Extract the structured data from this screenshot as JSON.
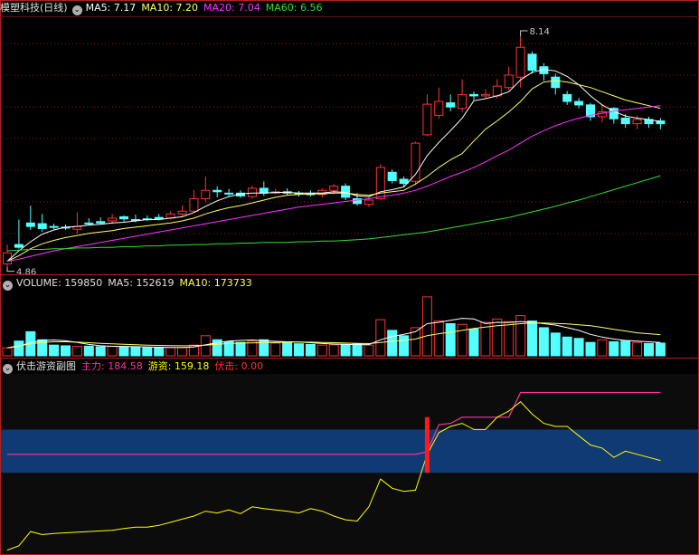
{
  "header": {
    "stock_name": "模塑科技(日线)",
    "ma5": "MA5: 7.17",
    "ma10": "MA10: 7.20",
    "ma20": "MA20: 7.04",
    "ma60": "MA60: 6.56"
  },
  "volume_header": {
    "volume": "VOLUME: 159850",
    "ma5": "MA5: 152619",
    "ma10": "MA10: 173733"
  },
  "indicator_header": {
    "name": "伏击游资副图",
    "zhuli": "主力: 184.58",
    "youzi": "游资: 159.18",
    "fuji": "伏击: 0.00"
  },
  "colors": {
    "up": "#ff3232",
    "down": "#54ffff",
    "ma5": "#ffffff",
    "ma10": "#ffff66",
    "ma20": "#ff33ff",
    "ma60": "#33dd33",
    "zhuli": "#ff3399",
    "youzi": "#ffff00",
    "band": "#103a74"
  },
  "chart_data": [
    {
      "type": "candlestick",
      "annotations": {
        "high": "8.14",
        "low": "4.86"
      },
      "ylim": [
        4.75,
        8.4
      ],
      "candles": [
        [
          4.86,
          5.02,
          4.82,
          5.14
        ],
        [
          5.14,
          5.1,
          5.08,
          5.5
        ],
        [
          5.45,
          5.4,
          5.35,
          5.7
        ],
        [
          5.44,
          5.37,
          5.32,
          5.58
        ],
        [
          5.4,
          5.39,
          5.36,
          5.44
        ],
        [
          5.39,
          5.38,
          5.35,
          5.43
        ],
        [
          5.36,
          5.4,
          5.3,
          5.6
        ],
        [
          5.45,
          5.44,
          5.42,
          5.52
        ],
        [
          5.47,
          5.45,
          5.43,
          5.53
        ],
        [
          5.48,
          5.52,
          5.44,
          5.58
        ],
        [
          5.54,
          5.51,
          5.47,
          5.56
        ],
        [
          5.5,
          5.49,
          5.46,
          5.57
        ],
        [
          5.51,
          5.5,
          5.48,
          5.56
        ],
        [
          5.53,
          5.51,
          5.49,
          5.58
        ],
        [
          5.52,
          5.58,
          5.5,
          5.62
        ],
        [
          5.58,
          5.62,
          5.55,
          5.7
        ],
        [
          5.62,
          5.8,
          5.6,
          5.92
        ],
        [
          5.8,
          5.92,
          5.75,
          6.12
        ],
        [
          5.92,
          5.9,
          5.82,
          5.98
        ],
        [
          5.88,
          5.87,
          5.83,
          5.94
        ],
        [
          5.88,
          5.84,
          5.81,
          5.92
        ],
        [
          5.83,
          5.95,
          5.8,
          5.99
        ],
        [
          5.95,
          5.88,
          5.84,
          6.05
        ],
        [
          5.88,
          5.9,
          5.86,
          5.94
        ],
        [
          5.9,
          5.88,
          5.85,
          5.95
        ],
        [
          5.88,
          5.87,
          5.83,
          5.91
        ],
        [
          5.87,
          5.86,
          5.83,
          5.92
        ],
        [
          5.86,
          5.92,
          5.82,
          5.95
        ],
        [
          5.92,
          5.98,
          5.86,
          6.01
        ],
        [
          5.98,
          5.82,
          5.78,
          6.02
        ],
        [
          5.8,
          5.73,
          5.7,
          5.88
        ],
        [
          5.72,
          5.78,
          5.68,
          5.82
        ],
        [
          5.8,
          6.25,
          5.78,
          6.3
        ],
        [
          6.18,
          6.06,
          6.02,
          6.22
        ],
        [
          6.08,
          6.02,
          5.98,
          6.12
        ],
        [
          6.05,
          6.6,
          6.0,
          6.62
        ],
        [
          6.72,
          7.16,
          6.7,
          7.3
        ],
        [
          7.0,
          7.2,
          6.95,
          7.4
        ],
        [
          7.18,
          7.12,
          7.06,
          7.3
        ],
        [
          7.1,
          7.3,
          7.05,
          7.52
        ],
        [
          7.3,
          7.28,
          7.22,
          7.34
        ],
        [
          7.28,
          7.3,
          7.25,
          7.38
        ],
        [
          7.28,
          7.42,
          7.24,
          7.52
        ],
        [
          7.4,
          7.58,
          7.36,
          7.7
        ],
        [
          7.55,
          7.98,
          7.4,
          8.14
        ],
        [
          7.88,
          7.65,
          7.6,
          7.92
        ],
        [
          7.7,
          7.6,
          7.5,
          7.75
        ],
        [
          7.55,
          7.4,
          7.3,
          7.6
        ],
        [
          7.3,
          7.2,
          7.15,
          7.35
        ],
        [
          7.2,
          7.15,
          7.1,
          7.25
        ],
        [
          7.15,
          6.98,
          6.92,
          7.18
        ],
        [
          6.98,
          7.05,
          6.9,
          7.16
        ],
        [
          7.1,
          6.95,
          6.88,
          7.12
        ],
        [
          6.96,
          6.88,
          6.82,
          7.02
        ],
        [
          6.88,
          6.94,
          6.8,
          7.0
        ],
        [
          6.94,
          6.88,
          6.82,
          6.98
        ],
        [
          6.92,
          6.88,
          6.8,
          6.96
        ]
      ],
      "series": [
        {
          "name": "MA5",
          "values": [
            4.9,
            5.05,
            5.18,
            5.29,
            5.35,
            5.39,
            5.4,
            5.42,
            5.43,
            5.45,
            5.46,
            5.48,
            5.5,
            5.5,
            5.52,
            5.54,
            5.6,
            5.69,
            5.77,
            5.83,
            5.87,
            5.88,
            5.88,
            5.89,
            5.89,
            5.88,
            5.88,
            5.88,
            5.9,
            5.89,
            5.84,
            5.83,
            5.9,
            5.93,
            5.97,
            6.15,
            6.42,
            6.61,
            6.78,
            6.96,
            7.21,
            7.24,
            7.28,
            7.34,
            7.51,
            7.62,
            7.66,
            7.64,
            7.56,
            7.44,
            7.28,
            7.15,
            7.06,
            6.99,
            6.96,
            6.94,
            6.91
          ]
        },
        {
          "name": "MA10",
          "values": [
            4.9,
            4.98,
            5.08,
            5.15,
            5.2,
            5.24,
            5.27,
            5.3,
            5.32,
            5.34,
            5.37,
            5.39,
            5.41,
            5.43,
            5.45,
            5.48,
            5.52,
            5.58,
            5.63,
            5.67,
            5.7,
            5.74,
            5.78,
            5.82,
            5.85,
            5.86,
            5.87,
            5.87,
            5.88,
            5.88,
            5.86,
            5.85,
            5.88,
            5.9,
            5.92,
            6.01,
            6.12,
            6.25,
            6.36,
            6.45,
            6.63,
            6.8,
            6.92,
            7.05,
            7.2,
            7.38,
            7.48,
            7.5,
            7.48,
            7.44,
            7.4,
            7.34,
            7.28,
            7.22,
            7.18,
            7.14,
            7.1
          ]
        },
        {
          "name": "MA20",
          "values": [
            4.9,
            4.93,
            4.97,
            5.01,
            5.05,
            5.08,
            5.11,
            5.14,
            5.17,
            5.2,
            5.23,
            5.26,
            5.29,
            5.32,
            5.35,
            5.38,
            5.41,
            5.44,
            5.47,
            5.5,
            5.53,
            5.56,
            5.59,
            5.62,
            5.65,
            5.68,
            5.7,
            5.72,
            5.74,
            5.76,
            5.78,
            5.8,
            5.83,
            5.85,
            5.88,
            5.92,
            5.98,
            6.05,
            6.12,
            6.18,
            6.25,
            6.33,
            6.42,
            6.5,
            6.6,
            6.7,
            6.78,
            6.85,
            6.91,
            6.96,
            7.0,
            7.03,
            7.06,
            7.08,
            7.1,
            7.12,
            7.14
          ]
        },
        {
          "name": "MA60",
          "values": [
            5.05,
            5.06,
            5.07,
            5.07,
            5.08,
            5.08,
            5.09,
            5.09,
            5.1,
            5.1,
            5.11,
            5.11,
            5.12,
            5.12,
            5.13,
            5.13,
            5.14,
            5.14,
            5.15,
            5.15,
            5.16,
            5.16,
            5.17,
            5.17,
            5.17,
            5.18,
            5.18,
            5.19,
            5.19,
            5.2,
            5.21,
            5.22,
            5.24,
            5.26,
            5.28,
            5.3,
            5.32,
            5.35,
            5.38,
            5.41,
            5.44,
            5.47,
            5.5,
            5.53,
            5.57,
            5.61,
            5.65,
            5.69,
            5.74,
            5.78,
            5.83,
            5.88,
            5.93,
            5.98,
            6.03,
            6.08,
            6.13
          ]
        }
      ]
    },
    {
      "type": "bar",
      "ylim": [
        0,
        480000
      ],
      "values": [
        60000,
        110000,
        180000,
        120000,
        80000,
        75000,
        70000,
        72000,
        68000,
        70000,
        65000,
        66000,
        60000,
        62000,
        61000,
        60000,
        80000,
        150000,
        120000,
        105000,
        100000,
        110000,
        120000,
        95000,
        98000,
        90000,
        85000,
        80000,
        82000,
        85000,
        88000,
        80000,
        270000,
        190000,
        150000,
        210000,
        440000,
        260000,
        240000,
        235000,
        200000,
        250000,
        275000,
        255000,
        300000,
        260000,
        210000,
        170000,
        140000,
        130000,
        100000,
        120000,
        105000,
        110000,
        100000,
        92000,
        95000
      ],
      "series": [
        {
          "name": "MA5",
          "values": [
            60000,
            70000,
            100000,
            115000,
            118000,
            112000,
            100000,
            85000,
            75000,
            71000,
            70000,
            68000,
            66000,
            64000,
            62000,
            62000,
            66000,
            82000,
            98000,
            110000,
            115000,
            118000,
            112000,
            108000,
            105000,
            103000,
            98000,
            92000,
            88000,
            85000,
            84000,
            84000,
            120000,
            145000,
            160000,
            180000,
            240000,
            250000,
            265000,
            280000,
            275000,
            240000,
            250000,
            248000,
            256000,
            250000,
            240000,
            230000,
            210000,
            190000,
            160000,
            140000,
            125000,
            115000,
            110000,
            105000,
            100000
          ]
        },
        {
          "name": "MA10",
          "values": [
            60000,
            75000,
            90000,
            100000,
            105000,
            105000,
            102000,
            98000,
            93000,
            90000,
            86000,
            83000,
            80000,
            78000,
            76000,
            75000,
            76000,
            80000,
            86000,
            92000,
            95000,
            97000,
            98000,
            100000,
            102000,
            103000,
            102000,
            100000,
            98000,
            95000,
            93000,
            91000,
            100000,
            108000,
            115000,
            125000,
            150000,
            165000,
            178000,
            190000,
            205000,
            215000,
            225000,
            232000,
            240000,
            245000,
            245000,
            242000,
            238000,
            232000,
            225000,
            212000,
            198000,
            185000,
            172000,
            165000,
            158000
          ]
        }
      ]
    },
    {
      "type": "line",
      "ylim": [
        -60,
        230
      ],
      "band": [
        70,
        140
      ],
      "signal_index": 36,
      "series": [
        {
          "name": "主力",
          "values": [
            100,
            100,
            100,
            100,
            100,
            100,
            100,
            100,
            100,
            100,
            100,
            100,
            100,
            100,
            100,
            100,
            100,
            100,
            100,
            100,
            100,
            100,
            100,
            100,
            100,
            100,
            100,
            100,
            100,
            100,
            100,
            100,
            100,
            100,
            100,
            100,
            104,
            148,
            150,
            160,
            160,
            160,
            160,
            160,
            200,
            200,
            200,
            200,
            200,
            200,
            200,
            200,
            200,
            200,
            200,
            200,
            200
          ]
        },
        {
          "name": "游资",
          "values": [
            -55,
            -48,
            -25,
            -30,
            -28,
            -27,
            -26,
            -25,
            -24,
            -23,
            -20,
            -18,
            -18,
            -15,
            -10,
            -5,
            0,
            8,
            5,
            10,
            4,
            15,
            12,
            10,
            8,
            5,
            12,
            8,
            0,
            -6,
            -8,
            15,
            60,
            45,
            40,
            42,
            100,
            135,
            145,
            150,
            140,
            140,
            160,
            170,
            185,
            165,
            150,
            145,
            145,
            130,
            115,
            110,
            95,
            105,
            100,
            95,
            90
          ]
        }
      ]
    }
  ]
}
